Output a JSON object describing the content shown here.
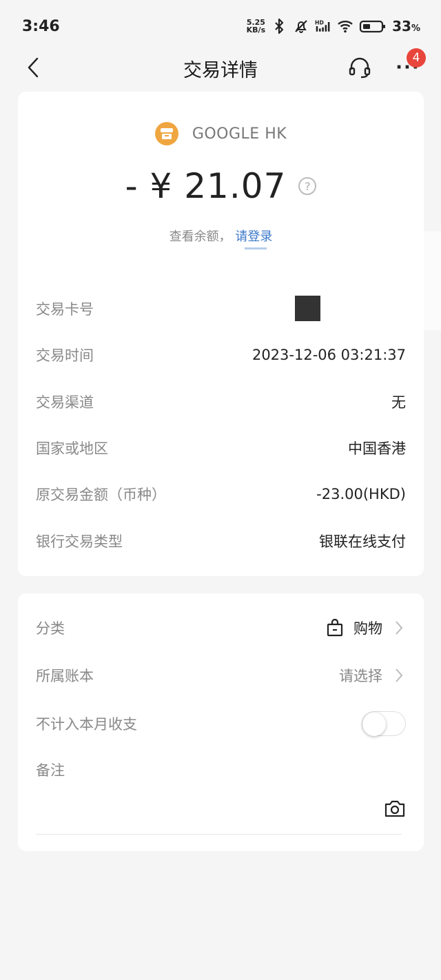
{
  "status_bar": {
    "time": "3:46",
    "net_speed_value": "5.25",
    "net_speed_unit": "KB/s",
    "battery_percent": "33",
    "battery_unit": "%"
  },
  "header": {
    "title": "交易详情",
    "badge_count": "4"
  },
  "merchant": {
    "name": "GOOGLE HK",
    "amount": "- ¥ 21.07",
    "help_symbol": "?"
  },
  "balance": {
    "text": "查看余额，",
    "login": "请登录"
  },
  "details": [
    {
      "label": "交易卡号",
      "value": ""
    },
    {
      "label": "交易时间",
      "value": "2023-12-06 03:21:37"
    },
    {
      "label": "交易渠道",
      "value": "无"
    },
    {
      "label": "国家或地区",
      "value": "中国香港"
    },
    {
      "label": "原交易金额（币种）",
      "value": "-23.00(HKD)"
    },
    {
      "label": "银行交易类型",
      "value": "银联在线支付"
    }
  ],
  "category": {
    "label": "分类",
    "value": "购物"
  },
  "account_book": {
    "label": "所属账本",
    "value": "请选择"
  },
  "exclude_month": {
    "label": "不计入本月收支",
    "enabled": false
  },
  "note": {
    "label": "备注"
  },
  "icons": {
    "back": "chevron-left-icon",
    "service": "headset-icon",
    "more": "more-dots-icon",
    "merchant": "store-icon",
    "category": "shopping-bag-icon",
    "camera": "camera-icon"
  },
  "colors": {
    "link": "#3a78c9",
    "badge": "#e8453c",
    "merchant_logo": "#f0a640"
  }
}
